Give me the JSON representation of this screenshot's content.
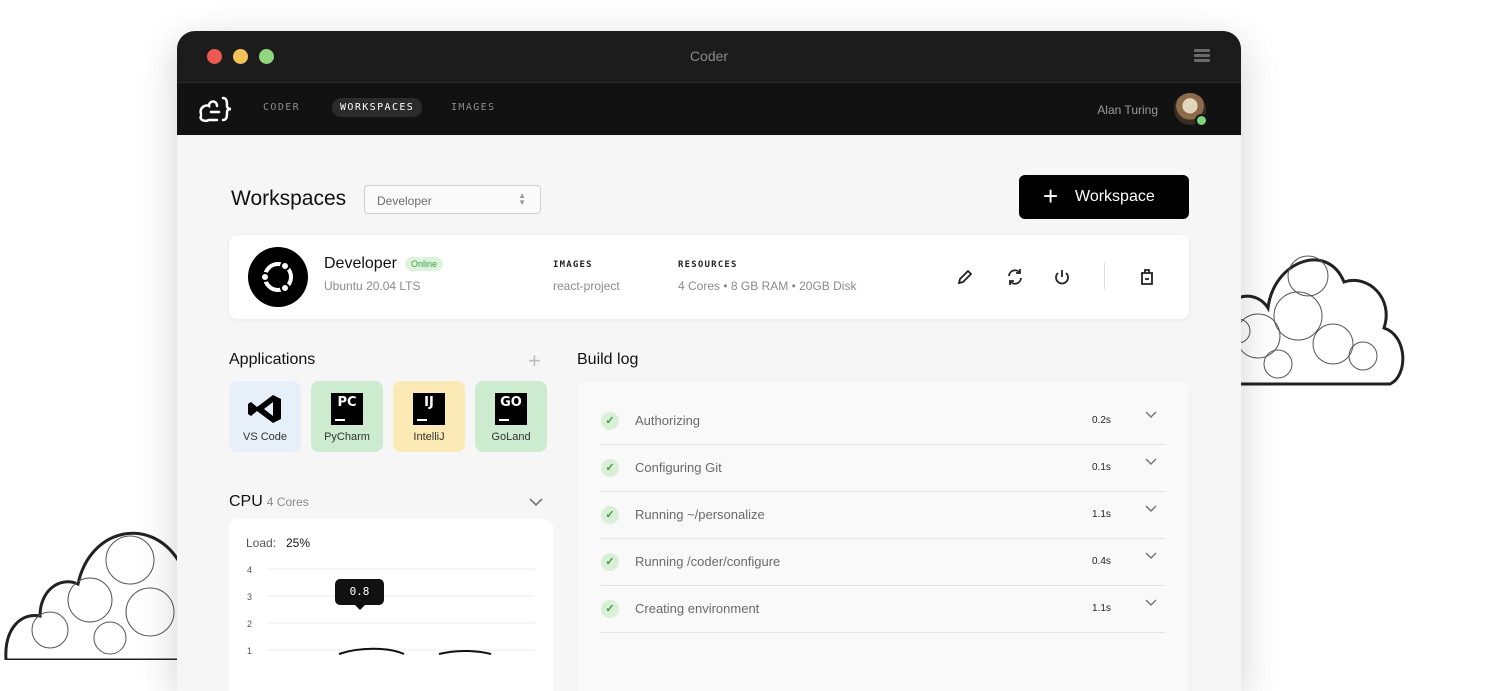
{
  "window": {
    "title": "Coder"
  },
  "nav": {
    "items": [
      "CODER",
      "WORKSPACES",
      "IMAGES"
    ],
    "active": "WORKSPACES",
    "user_name": "Alan Turing"
  },
  "header": {
    "title": "Workspaces",
    "filter_value": "Developer",
    "add_button_label": "Workspace"
  },
  "workspace": {
    "name": "Developer",
    "status": "Online",
    "os": "Ubuntu 20.04 LTS",
    "images_label": "IMAGES",
    "images_value": "react-project",
    "resources_label": "RESOURCES",
    "resources_value": "4 Cores • 8 GB RAM • 20GB Disk",
    "icons": [
      "ubuntu-icon",
      "edit-icon",
      "refresh-icon",
      "power-icon",
      "delete-icon"
    ]
  },
  "applications": {
    "title": "Applications",
    "items": [
      {
        "name": "VS Code",
        "logo": "vscode",
        "bg": "#e7f0f8"
      },
      {
        "name": "PyCharm",
        "logo": "PC",
        "bg": "#cdebcf"
      },
      {
        "name": "IntelliJ",
        "logo": "IJ",
        "bg": "#fbeab5"
      },
      {
        "name": "GoLand",
        "logo": "GO",
        "bg": "#cdebcf"
      }
    ]
  },
  "cpu": {
    "title": "CPU",
    "subtitle": "4 Cores",
    "load_label": "Load:",
    "load_value": "25%",
    "tooltip": "0.8",
    "chart_data": {
      "type": "line",
      "y_ticks": [
        "4",
        "3",
        "2",
        "1"
      ],
      "ylim": [
        0,
        4
      ]
    }
  },
  "build_log": {
    "title": "Build log",
    "rows": [
      {
        "label": "Authorizing",
        "time": "0.2s"
      },
      {
        "label": "Configuring Git",
        "time": "0.1s"
      },
      {
        "label": "Running ~/personalize",
        "time": "1.1s"
      },
      {
        "label": "Running /coder/configure",
        "time": "0.4s"
      },
      {
        "label": "Creating environment",
        "time": "1.1s"
      }
    ]
  },
  "colors": {
    "accent": "#000000",
    "online": "#3f9a4a",
    "online_bg": "#def3dc"
  }
}
